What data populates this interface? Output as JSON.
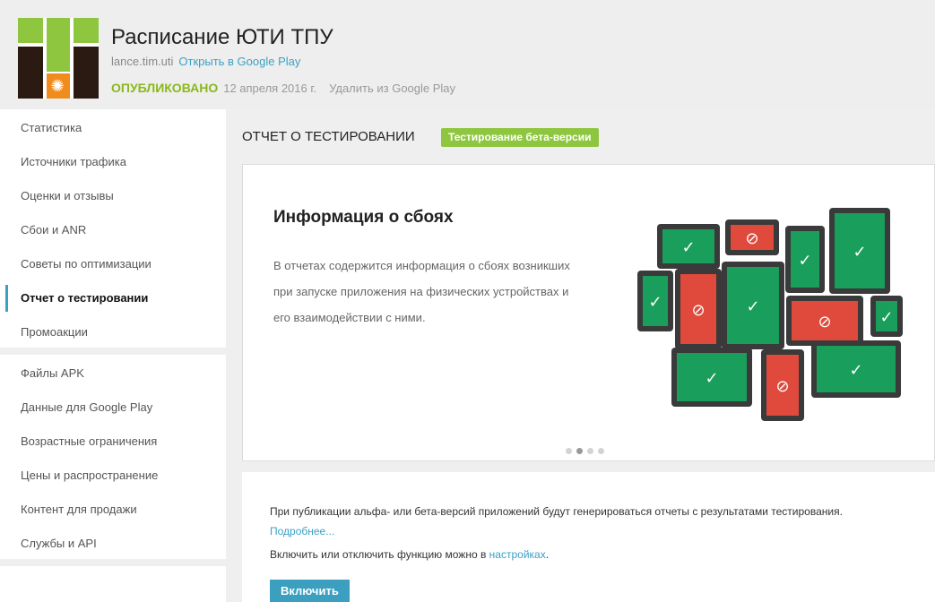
{
  "header": {
    "title": "Расписание ЮТИ ТПУ",
    "package": "lance.tim.uti",
    "open_link": "Открыть в Google Play",
    "status": "ОПУБЛИКОВАНО",
    "date": "12 апреля 2016 г.",
    "remove_link": "Удалить из Google Play"
  },
  "sidebar": {
    "items": [
      {
        "label": "Статистика"
      },
      {
        "label": "Источники трафика"
      },
      {
        "label": "Оценки и отзывы"
      },
      {
        "label": "Сбои и ANR"
      },
      {
        "label": "Советы по оптимизации"
      },
      {
        "label": "Отчет о тестировании"
      },
      {
        "label": "Промоакции"
      },
      {
        "label": "Файлы APK"
      },
      {
        "label": "Данные для Google Play"
      },
      {
        "label": "Возрастные ограничения"
      },
      {
        "label": "Цены и распространение"
      },
      {
        "label": "Контент для продажи"
      },
      {
        "label": "Службы и API"
      }
    ],
    "active_index": 5
  },
  "main": {
    "heading": "ОТЧЕТ О ТЕСТИРОВАНИИ",
    "badge": "Тестирование бета-версии",
    "card": {
      "title": "Информация о сбоях",
      "body": "В отчетах содержится информация о сбоях возникших при запуске приложения на физических устройствах и его взаимодействии с ними.",
      "carousel_total": 4,
      "carousel_active": 2
    },
    "info": {
      "text": "При публикации альфа- или бета-версий приложений будут генерироваться отчеты с результатами тестирования.",
      "more_link": "Подробнее...",
      "toggle_text": "Включить или отключить функцию можно в",
      "settings_link": "настройках",
      "button": "Включить"
    }
  },
  "colors": {
    "accent": "#3aa1c5",
    "published": "#8ab81a",
    "badge": "#8ec63f",
    "device_ok": "#1a9e5b",
    "device_fail": "#e04a3c",
    "device_frame": "#3a3a3a"
  },
  "icons": {
    "ok": "checkmark-icon",
    "fail": "blocked-icon"
  }
}
